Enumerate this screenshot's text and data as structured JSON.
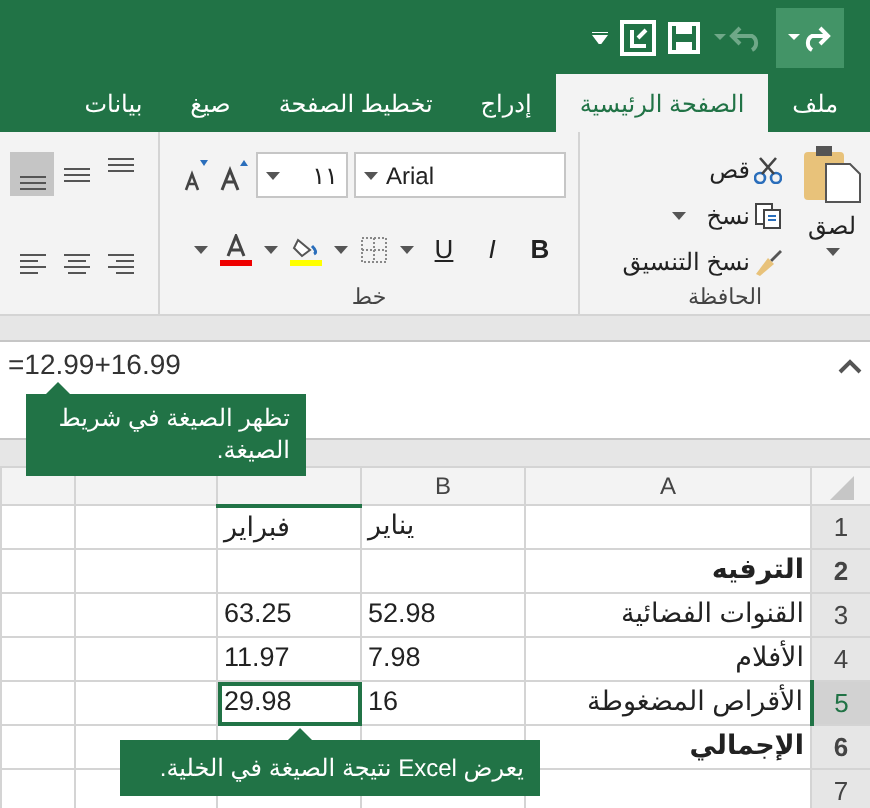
{
  "ribbon_tabs": [
    {
      "label": "ملف",
      "selected": false
    },
    {
      "label": "الصفحة الرئيسية",
      "selected": true
    },
    {
      "label": "إدراج",
      "selected": false
    },
    {
      "label": "تخطيط الصفحة",
      "selected": false
    },
    {
      "label": "صيغ",
      "selected": false
    },
    {
      "label": "بيانات",
      "selected": false
    }
  ],
  "clipboard": {
    "paste": "لصق",
    "cut": "قص",
    "copy": "نسخ",
    "format_painter": "نسخ التنسيق",
    "group_label": "الحافظة"
  },
  "font": {
    "name": "Arial",
    "size": "١١",
    "bold": "B",
    "italic": "I",
    "underline": "U",
    "group_label": "خط"
  },
  "alignment": [
    {
      "kind": "top",
      "selected": false
    },
    {
      "kind": "middle",
      "selected": false
    },
    {
      "kind": "bottom",
      "selected": true
    },
    {
      "kind": "right",
      "selected": false
    },
    {
      "kind": "center",
      "selected": false
    },
    {
      "kind": "left",
      "selected": false
    }
  ],
  "formula_bar": {
    "value": "=12.99+16.99"
  },
  "callouts": [
    {
      "kind": "formula",
      "text": "تظهر الصيغة في شريط الصيغة."
    },
    {
      "kind": "cell",
      "text": "يعرض Excel نتيجة الصيغة في الخلية."
    }
  ],
  "sheet": {
    "columns": [
      "A",
      "B"
    ],
    "rows": [
      {
        "header": "1",
        "selected": false,
        "bold": false,
        "cells": [
          "",
          "يناير",
          "فبراير"
        ]
      },
      {
        "header": "2",
        "selected": false,
        "bold": true,
        "cells": [
          "الترفيه",
          "",
          ""
        ]
      },
      {
        "header": "3",
        "selected": false,
        "bold": false,
        "cells": [
          "القنوات الفضائية",
          "52.98",
          "63.25"
        ]
      },
      {
        "header": "4",
        "selected": false,
        "bold": false,
        "cells": [
          "الأفلام",
          "7.98",
          "11.97"
        ]
      },
      {
        "header": "5",
        "selected": true,
        "bold": false,
        "cells": [
          "الأقراص المضغوطة",
          "16",
          "29.98"
        ]
      },
      {
        "header": "6",
        "selected": false,
        "bold": true,
        "cells": [
          "الإجمالي",
          "",
          ""
        ]
      },
      {
        "header": "7",
        "selected": false,
        "bold": false,
        "cells": [
          "",
          "",
          ""
        ]
      }
    ]
  }
}
